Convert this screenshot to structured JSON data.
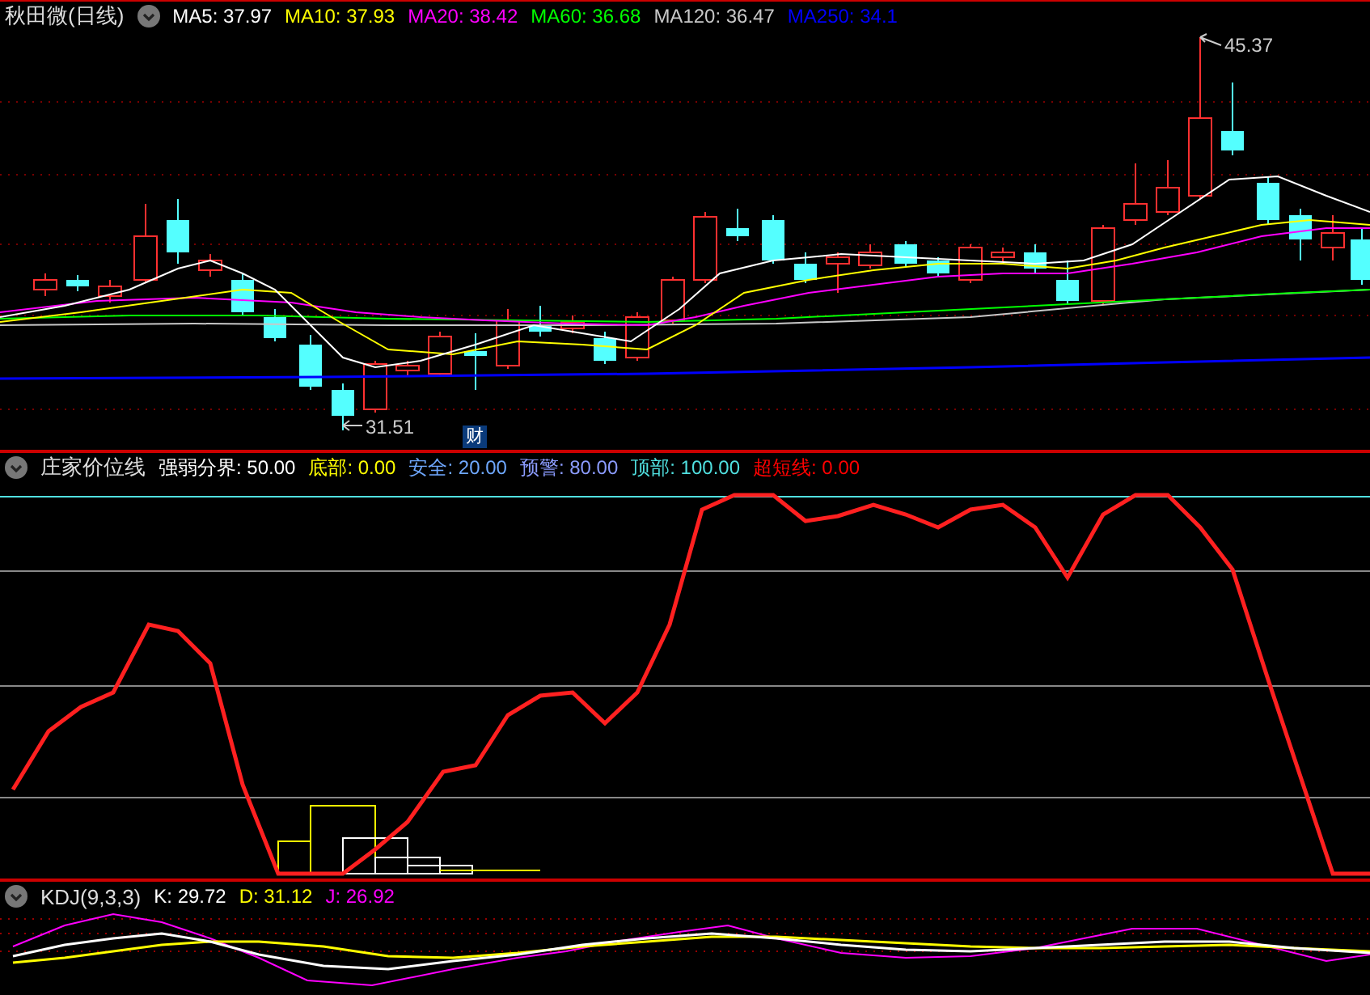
{
  "main_chart": {
    "title": "秋田微(日线)",
    "indicators": [
      {
        "label": "MA5:",
        "value": "37.97",
        "color": "#ffffff"
      },
      {
        "label": "MA10:",
        "value": "37.93",
        "color": "#ffff00"
      },
      {
        "label": "MA20:",
        "value": "38.42",
        "color": "#ff00ff"
      },
      {
        "label": "MA60:",
        "value": "36.68",
        "color": "#00ff00"
      },
      {
        "label": "MA120:",
        "value": "36.47",
        "color": "#c8c8c8"
      },
      {
        "label": "MA250:",
        "value": "34.1",
        "color": "#0000ff"
      }
    ],
    "high_label": "45.37",
    "low_label": "31.51",
    "marker": "财"
  },
  "indicator_chart": {
    "title": "庄家价位线",
    "indicators": [
      {
        "label": "强弱分界:",
        "value": "50.00",
        "color": "#ffffff"
      },
      {
        "label": "底部:",
        "value": "0.00",
        "color": "#ffff00"
      },
      {
        "label": "安全:",
        "value": "20.00",
        "color": "#6fa8ff"
      },
      {
        "label": "预警:",
        "value": "80.00",
        "color": "#8c9cff"
      },
      {
        "label": "顶部:",
        "value": "100.00",
        "color": "#50e0e0"
      },
      {
        "label": "超短线:",
        "value": "0.00",
        "color": "#ff0000"
      }
    ]
  },
  "kdj_chart": {
    "title": "KDJ(9,3,3)",
    "indicators": [
      {
        "label": "K:",
        "value": "29.72",
        "color": "#ffffff"
      },
      {
        "label": "D:",
        "value": "31.12",
        "color": "#ffff00"
      },
      {
        "label": "J:",
        "value": "26.92",
        "color": "#ff00ff"
      }
    ]
  }
}
